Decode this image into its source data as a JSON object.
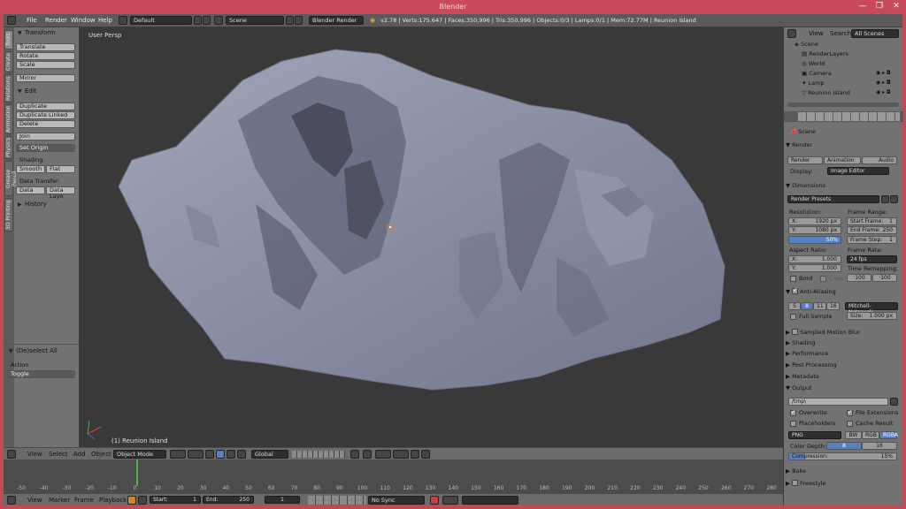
{
  "window": {
    "title": "Blender"
  },
  "infobar": {
    "menus": [
      "File",
      "Render",
      "Window",
      "Help"
    ],
    "screen_layout": "Default",
    "scene": "Scene",
    "render_engine": "Blender Render",
    "stats": "v2.78 | Verts:175,647 | Faces:350,996 | Tris:350,996 | Objects:0/3 | Lamps:0/1 | Mem:72.77M | Reunion Island"
  },
  "toolshelf": {
    "tabs": [
      "Tools",
      "Create",
      "Relations",
      "Animation",
      "Physics",
      "Grease Pencil",
      "3D Printing"
    ],
    "transform_header": "Transform",
    "transform_buttons": [
      "Translate",
      "Rotate",
      "Scale"
    ],
    "mirror": "Mirror",
    "edit_header": "Edit",
    "edit_buttons": [
      "Duplicate",
      "Duplicate Linked",
      "Delete"
    ],
    "join": "Join",
    "set_origin": "Set Origin",
    "shading_label": "Shading:",
    "smooth": "Smooth",
    "flat": "Flat",
    "data_transfer_label": "Data Transfer:",
    "data": "Data",
    "data_layout": "Data Layo",
    "history_header": "History",
    "operator_header": "(De)select All",
    "action_label": "Action",
    "action_value": "Toggle"
  },
  "viewport": {
    "view_label": "User Persp",
    "object_label": "(1) Reunion Island"
  },
  "view3d_header": {
    "menus": [
      "View",
      "Select",
      "Add",
      "Object"
    ],
    "mode": "Object Mode",
    "orientation": "Global"
  },
  "timeline": {
    "ticks": [
      "-50",
      "-40",
      "-30",
      "-20",
      "-10",
      "0",
      "10",
      "20",
      "30",
      "40",
      "50",
      "60",
      "70",
      "80",
      "90",
      "100",
      "110",
      "120",
      "130",
      "140",
      "150",
      "160",
      "170",
      "180",
      "190",
      "200",
      "210",
      "220",
      "230",
      "240",
      "250",
      "260",
      "270",
      "280"
    ],
    "menus": [
      "View",
      "Marker",
      "Frame",
      "Playback"
    ],
    "start_label": "Start:",
    "start_value": "1",
    "end_label": "End:",
    "end_value": "250",
    "current_frame": "1",
    "sync": "No Sync"
  },
  "outliner": {
    "view": "View",
    "search": "Search",
    "filter": "All Scenes",
    "items": [
      "Scene",
      "RenderLayers",
      "World",
      "Camera",
      "Lamp",
      "Reunion Island"
    ]
  },
  "properties": {
    "context": "Scene",
    "render_header": "Render",
    "render_btn": "Render",
    "animation_btn": "Animation",
    "audio_btn": "Audio",
    "display_label": "Display:",
    "display_value": "Image Editor",
    "dimensions_header": "Dimensions",
    "render_presets": "Render Presets",
    "resolution_label": "Resolution:",
    "res_x": "X:",
    "res_x_val": "1920 px",
    "res_y": "Y:",
    "res_y_val": "1080 px",
    "res_pct": "50%",
    "frame_range_label": "Frame Range:",
    "start_frame": "Start Frame:",
    "start_frame_val": "1",
    "end_frame": "End Frame:",
    "end_frame_val": "250",
    "frame_step": "Frame Step:",
    "frame_step_val": "1",
    "aspect_label": "Aspect Ratio:",
    "asp_x": "X:",
    "asp_x_val": "1.000",
    "asp_y": "Y:",
    "asp_y_val": "1.000",
    "frame_rate_label": "Frame Rate:",
    "frame_rate_val": "24 fps",
    "time_remap_label": "Time Remapping:",
    "remap_old": "·100",
    "remap_new": "·100",
    "bord": "Bord",
    "crop": "Crop",
    "aa_header": "Anti-Aliasing",
    "aa_samples": [
      "5",
      "8",
      "11",
      "16"
    ],
    "aa_filter": "Mitchell-Netravali",
    "full_sample": "Full Sample",
    "size_label": "Size:",
    "size_val": "1.000 px",
    "collapsed": [
      "Sampled Motion Blur",
      "Shading",
      "Performance",
      "Post Processing",
      "Metadata"
    ],
    "output_header": "Output",
    "output_path": "/tmp\\",
    "overwrite": "Overwrite",
    "file_ext": "File Extensions",
    "placeholders": "Placeholders",
    "cache_result": "Cache Result",
    "format": "PNG",
    "bw": "BW",
    "rgb": "RGB",
    "rgba": "RGBA",
    "color_depth_label": "Color Depth:",
    "depth_8": "8",
    "depth_16": "16",
    "compression_label": "Compression:",
    "compression_val": "15%",
    "bake": "Bake",
    "freestyle": "Freestyle"
  },
  "colors": {
    "accent": "#5680c2",
    "titlebar": "#c94b59",
    "terrain": "#8a8fa6"
  }
}
